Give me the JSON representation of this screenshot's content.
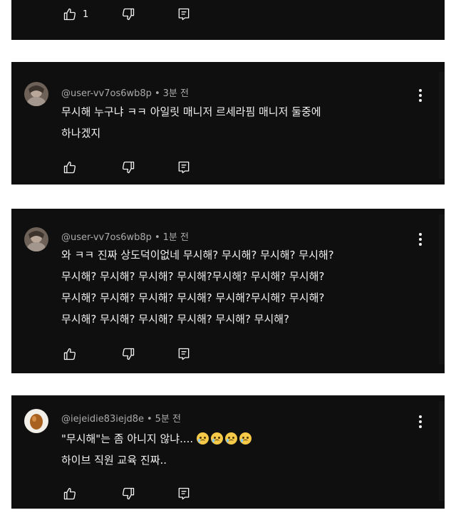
{
  "comments": [
    {
      "like_count": "1"
    },
    {
      "username": "@user-vv7os6wb8p",
      "separator": "•",
      "time": "3분 전",
      "lines": [
        "무시해 누구냐 ㅋㅋ 아일릿 매니저 르세라핌 매니저 둘중에",
        "하나겠지"
      ]
    },
    {
      "username": "@user-vv7os6wb8p",
      "separator": "•",
      "time": "1분 전",
      "lines": [
        "와 ㅋㅋ 진짜 상도덕이없네 무시해? 무시해? 무시해? 무시해?",
        "무시해? 무시해? 무시해? 무시해?무시해? 무시해? 무시해?",
        "무시해? 무시해? 무시해? 무시해? 무시해?무시해? 무시해?",
        "무시해? 무시해? 무시해? 무시해? 무시해? 무시해?"
      ]
    },
    {
      "username": "@iejeidie83iejd8e",
      "separator": "•",
      "time": "5분 전",
      "lines": [
        "\"무시해\"는 좀 아니지 않냐....",
        "하이브 직원 교육 진짜.."
      ]
    }
  ],
  "icons": {
    "like": "thumbs-up-icon",
    "dislike": "thumbs-down-icon",
    "reply": "reply-icon",
    "more": "more-vertical-icon",
    "emoji": "crying-face-emoji"
  },
  "colors": {
    "card_bg": "#0f0f0f",
    "text": "#f1f1f1",
    "meta": "#aaaaaa"
  }
}
